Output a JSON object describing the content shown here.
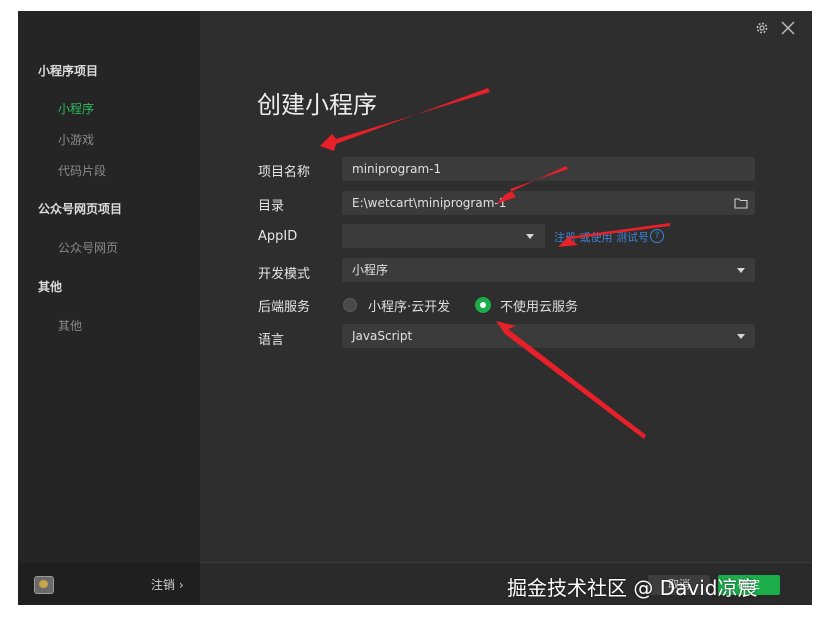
{
  "sidebar": {
    "sections": [
      {
        "title": "小程序项目",
        "items": [
          "小程序",
          "小游戏",
          "代码片段"
        ]
      },
      {
        "title": "公众号网页项目",
        "items": [
          "公众号网页"
        ]
      },
      {
        "title": "其他",
        "items": [
          "其他"
        ]
      }
    ],
    "active_item": "小程序",
    "logout_label": "注销 ›"
  },
  "header": {
    "settings_icon": "gear-icon",
    "close_icon": "close-icon"
  },
  "page_title": "创建小程序",
  "form": {
    "project_name": {
      "label": "项目名称",
      "value": "miniprogram-1"
    },
    "directory": {
      "label": "目录",
      "value": "E:\\wetcart\\miniprogram-1",
      "icon": "folder-icon"
    },
    "appid": {
      "label": "AppID",
      "value": "",
      "hint": "注册 或使用 测试号"
    },
    "dev_mode": {
      "label": "开发模式",
      "value": "小程序"
    },
    "backend": {
      "label": "后端服务",
      "options": [
        "小程序·云开发",
        "不使用云服务"
      ],
      "selected": "不使用云服务"
    },
    "language": {
      "label": "语言",
      "value": "JavaScript"
    }
  },
  "footer": {
    "cancel_label": "取消",
    "confirm_label": "确定"
  },
  "watermark": "掘金技术社区 @ David凉宸",
  "colors": {
    "accent": "#1aad4a",
    "link": "#3d84d6",
    "arrow": "#e8202a"
  }
}
